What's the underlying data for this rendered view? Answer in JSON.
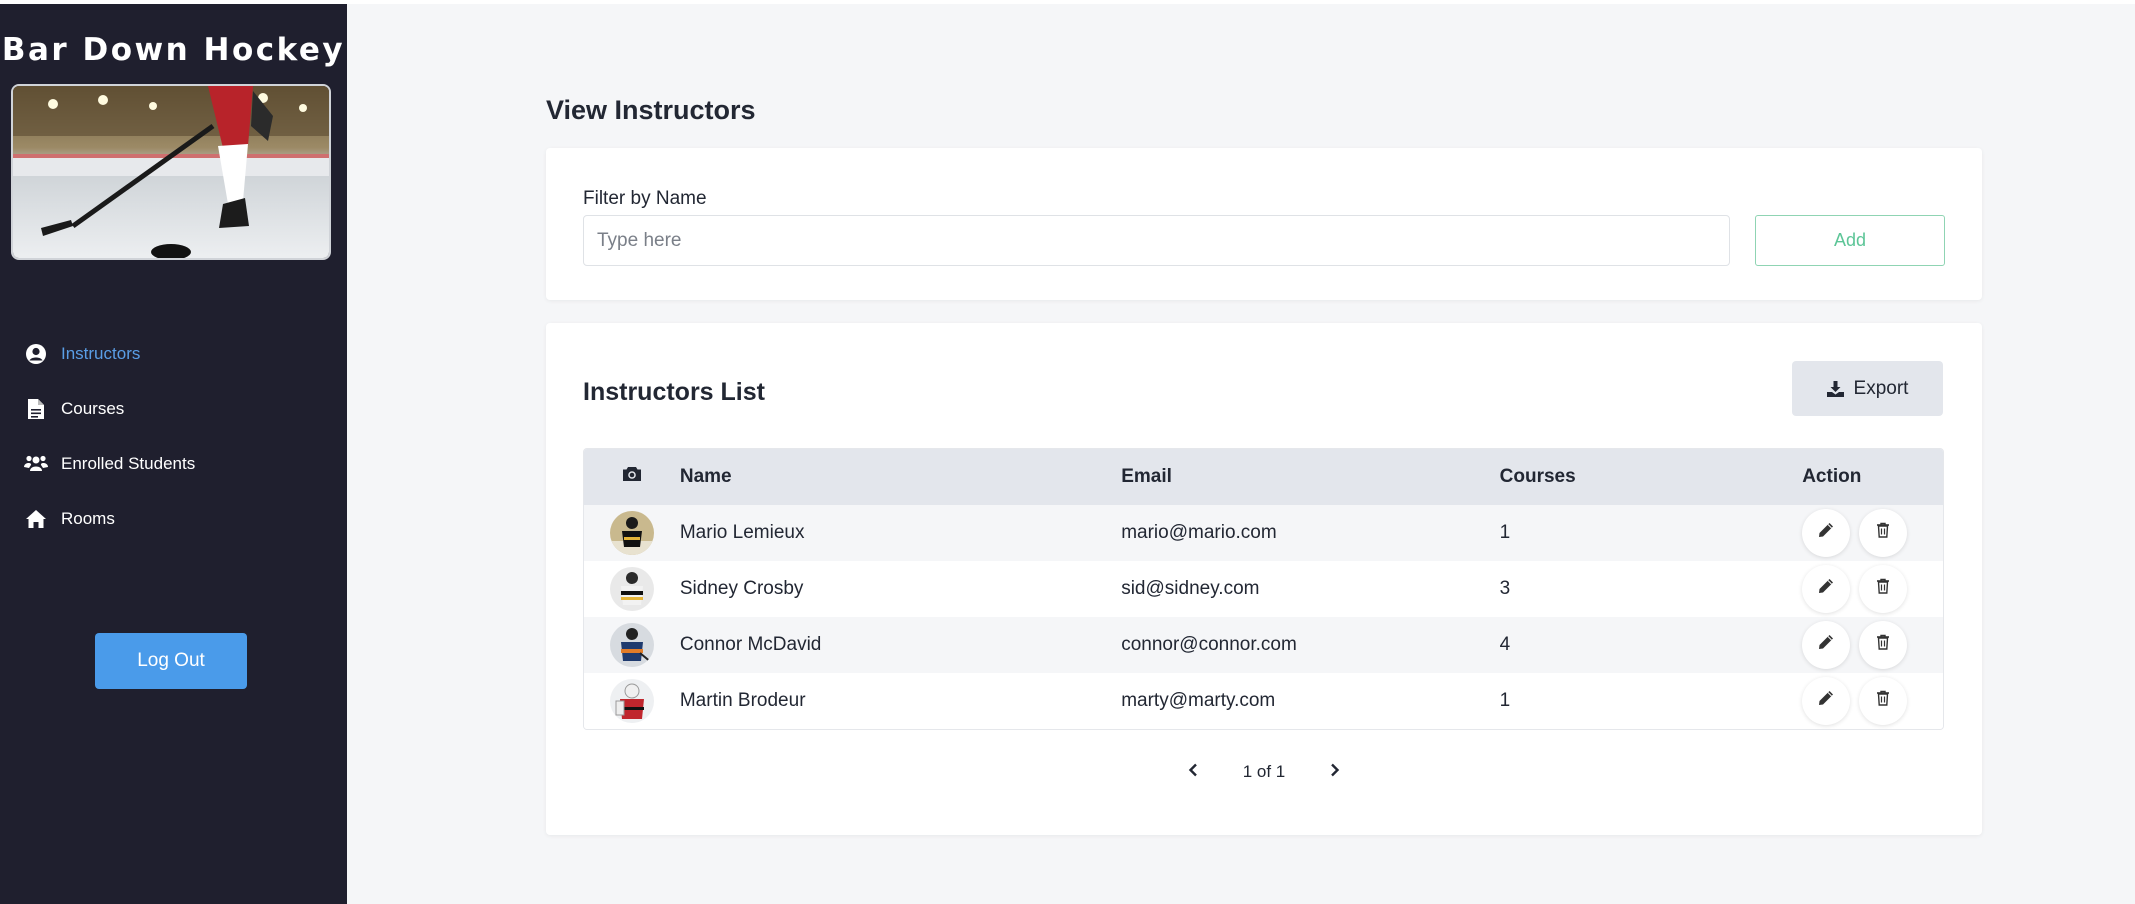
{
  "brand": {
    "title": "Bar Down Hockey"
  },
  "sidebar": {
    "items": [
      {
        "label": "Instructors",
        "icon": "user-circle-icon",
        "active": true
      },
      {
        "label": "Courses",
        "icon": "document-icon",
        "active": false
      },
      {
        "label": "Enrolled Students",
        "icon": "users-icon",
        "active": false
      },
      {
        "label": "Rooms",
        "icon": "home-icon",
        "active": false
      }
    ],
    "logout_label": "Log Out"
  },
  "page": {
    "title": "View Instructors"
  },
  "filter": {
    "label": "Filter by Name",
    "placeholder": "Type here",
    "value": "",
    "add_label": "Add"
  },
  "list": {
    "title": "Instructors List",
    "export_label": "Export",
    "columns": {
      "photo": "camera-icon",
      "name": "Name",
      "email": "Email",
      "courses": "Courses",
      "action": "Action"
    },
    "rows": [
      {
        "name": "Mario Lemieux",
        "email": "mario@mario.com",
        "courses": "1"
      },
      {
        "name": "Sidney Crosby",
        "email": "sid@sidney.com",
        "courses": "3"
      },
      {
        "name": "Connor McDavid",
        "email": "connor@connor.com",
        "courses": "4"
      },
      {
        "name": "Martin Brodeur",
        "email": "marty@marty.com",
        "courses": "1"
      }
    ],
    "pagination": {
      "text": "1 of 1"
    }
  },
  "colors": {
    "sidebar_bg": "#1f1f2e",
    "active_nav": "#5a9ee6",
    "logout_bg": "#4a9bea",
    "add_accent": "#5cc597",
    "table_header_bg": "#e3e6ec"
  }
}
